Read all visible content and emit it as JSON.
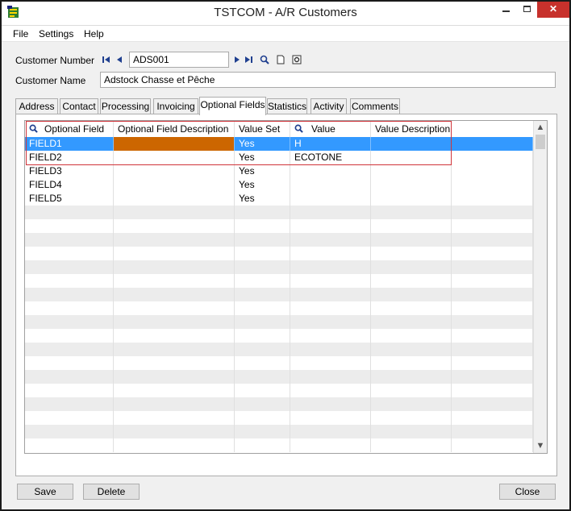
{
  "window": {
    "title": "TSTCOM - A/R Customers",
    "icon": "accpac-app-icon",
    "controls": {
      "minimize": "minimize-icon",
      "maximize": "maximize-icon",
      "close": "✕"
    }
  },
  "menu": [
    "File",
    "Settings",
    "Help"
  ],
  "form": {
    "customer_number_label": "Customer Number",
    "customer_number_value": "ADS001",
    "customer_name_label": "Customer Name",
    "customer_name_value": "Adstock Chasse et Pêche"
  },
  "tabs": [
    {
      "label": "Address",
      "active": false
    },
    {
      "label": "Contact",
      "active": false
    },
    {
      "label": "Processing",
      "active": false
    },
    {
      "label": "Invoicing",
      "active": false
    },
    {
      "label": "Optional Fields",
      "active": true
    },
    {
      "label": "Statistics",
      "active": false
    },
    {
      "label": "Activity",
      "active": false
    },
    {
      "label": "Comments",
      "active": false
    }
  ],
  "grid": {
    "columns": [
      "Optional Field",
      "Optional Field Description",
      "Value Set",
      "Value",
      "Value Description"
    ],
    "rows": [
      [
        "FIELD1",
        "",
        "Yes",
        "H",
        ""
      ],
      [
        "FIELD2",
        "",
        "Yes",
        "ECOTONE",
        ""
      ],
      [
        "FIELD3",
        "",
        "Yes",
        "",
        ""
      ],
      [
        "FIELD4",
        "",
        "Yes",
        "",
        ""
      ],
      [
        "FIELD5",
        "",
        "Yes",
        "",
        ""
      ]
    ],
    "selected_row": 0,
    "colors": {
      "selection": "#3399ff",
      "edit_cell": "#cc6600",
      "highlight_box": "#d0343a"
    }
  },
  "buttons": {
    "save": "Save",
    "delete": "Delete",
    "close": "Close"
  }
}
